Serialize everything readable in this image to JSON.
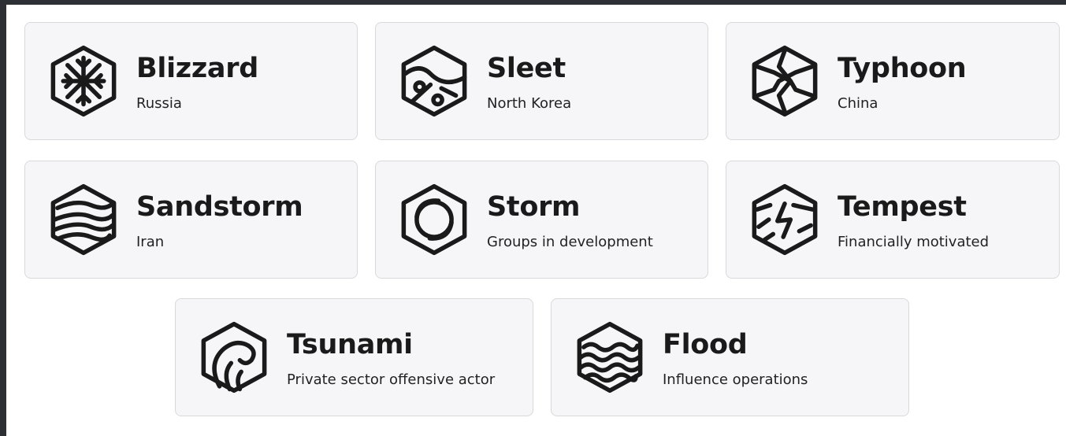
{
  "cards": [
    {
      "title": "Blizzard",
      "subtitle": "Russia",
      "icon": "snowflake-hexagon-icon"
    },
    {
      "title": "Sleet",
      "subtitle": "North Korea",
      "icon": "sleet-hexagon-icon"
    },
    {
      "title": "Typhoon",
      "subtitle": "China",
      "icon": "typhoon-hexagon-icon"
    },
    {
      "title": "Sandstorm",
      "subtitle": "Iran",
      "icon": "sandstorm-hexagon-icon"
    },
    {
      "title": "Storm",
      "subtitle": "Groups in development",
      "icon": "storm-hexagon-icon"
    },
    {
      "title": "Tempest",
      "subtitle": "Financially motivated",
      "icon": "tempest-hexagon-icon"
    },
    {
      "title": "Tsunami",
      "subtitle": "Private sector offensive actor",
      "icon": "tsunami-hexagon-icon"
    },
    {
      "title": "Flood",
      "subtitle": "Influence operations",
      "icon": "flood-hexagon-icon"
    }
  ]
}
